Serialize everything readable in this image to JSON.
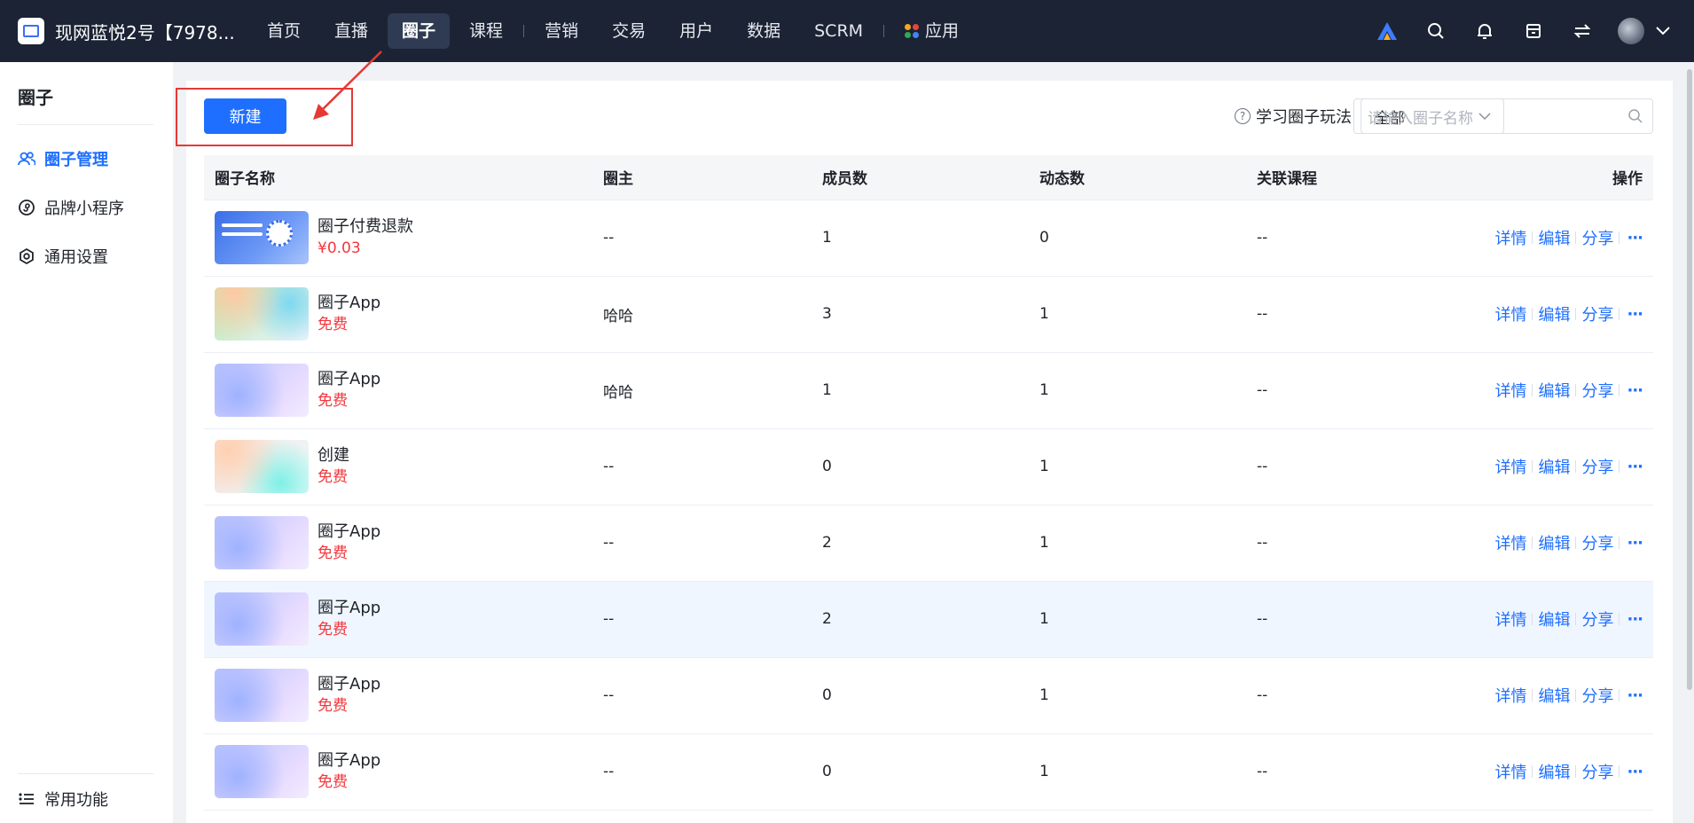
{
  "header": {
    "store_name": "现网蓝悦2号【7978...",
    "nav": [
      {
        "label": "首页"
      },
      {
        "label": "直播"
      },
      {
        "label": "圈子",
        "active": true
      },
      {
        "label": "课程"
      },
      {
        "label": "营销"
      },
      {
        "label": "交易"
      },
      {
        "label": "用户"
      },
      {
        "label": "数据"
      },
      {
        "label": "SCRM"
      },
      {
        "label": "应用"
      }
    ],
    "icons": [
      "ai-logo-icon",
      "search-icon",
      "bell-icon",
      "store-icon",
      "switch-icon",
      "avatar",
      "chevron-down-icon"
    ]
  },
  "sidebar": {
    "title": "圈子",
    "items": [
      {
        "label": "圈子管理",
        "icon": "users-icon",
        "active": true
      },
      {
        "label": "品牌小程序",
        "icon": "mini-program-icon"
      },
      {
        "label": "通用设置",
        "icon": "gear-icon"
      }
    ],
    "bottom_item": {
      "label": "常用功能",
      "icon": "list-icon"
    }
  },
  "toolbar": {
    "new_label": "新建",
    "learn_label": "学习圈子玩法",
    "filter_value": "全部",
    "search_placeholder": "请输入圈子名称"
  },
  "table": {
    "columns": [
      "圈子名称",
      "圈主",
      "成员数",
      "动态数",
      "关联课程",
      "操作"
    ],
    "op_labels": {
      "detail": "详情",
      "edit": "编辑",
      "share": "分享",
      "more": "···"
    },
    "rows": [
      {
        "name": "圈子付费退款",
        "price": "¥0.03",
        "owner": "--",
        "members": "1",
        "posts": "0",
        "course": "--"
      },
      {
        "name": "圈子App",
        "price": "免费",
        "owner": "哈哈",
        "members": "3",
        "posts": "1",
        "course": "--"
      },
      {
        "name": "圈子App",
        "price": "免费",
        "owner": "哈哈",
        "members": "1",
        "posts": "1",
        "course": "--"
      },
      {
        "name": "创建",
        "price": "免费",
        "owner": "--",
        "members": "0",
        "posts": "1",
        "course": "--"
      },
      {
        "name": "圈子App",
        "price": "免费",
        "owner": "--",
        "members": "2",
        "posts": "1",
        "course": "--"
      },
      {
        "name": "圈子App",
        "price": "免费",
        "owner": "--",
        "members": "2",
        "posts": "1",
        "course": "--"
      },
      {
        "name": "圈子App",
        "price": "免费",
        "owner": "--",
        "members": "0",
        "posts": "1",
        "course": "--"
      },
      {
        "name": "圈子App",
        "price": "免费",
        "owner": "--",
        "members": "0",
        "posts": "1",
        "course": "--"
      }
    ]
  },
  "colors": {
    "accent": "#1e6fff",
    "price": "#f2373c",
    "topbar": "#1b2334",
    "annotation": "#e53935"
  }
}
